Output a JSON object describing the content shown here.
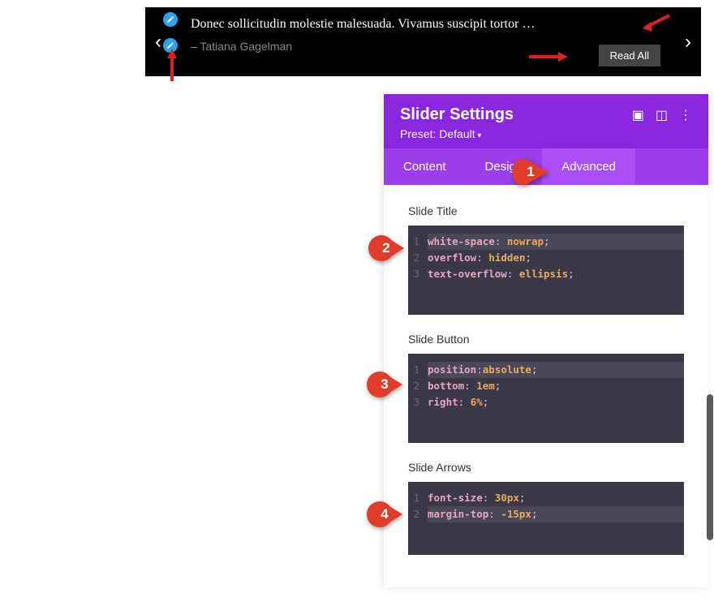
{
  "slider": {
    "quote": "Donec sollicitudin molestie malesuada. Vivamus suscipit tortor …",
    "author": "– Tatiana Gagelman",
    "read_all": "Read All"
  },
  "panel": {
    "title": "Slider Settings",
    "preset": "Preset: Default",
    "tabs": {
      "content": "Content",
      "design": "Design",
      "advanced": "Advanced"
    }
  },
  "sections": {
    "slide_title": {
      "label": "Slide Title",
      "lines": [
        {
          "n": "1",
          "prop": "white-space",
          "p1": ": ",
          "val": "nowrap",
          "p2": ";",
          "hl": true
        },
        {
          "n": "2",
          "prop": "overflow",
          "p1": ": ",
          "val": "hidden",
          "p2": ";",
          "hl": false
        },
        {
          "n": "3",
          "prop": "text-overflow",
          "p1": ": ",
          "val": "ellipsis",
          "p2": ";",
          "hl": false
        }
      ]
    },
    "slide_button": {
      "label": "Slide Button",
      "lines": [
        {
          "n": "1",
          "prop": "position",
          "p1": ":",
          "val": "absolute",
          "p2": ";",
          "hl": true
        },
        {
          "n": "2",
          "prop": "bottom",
          "p1": ": ",
          "val": "1em",
          "p2": ";",
          "hl": false
        },
        {
          "n": "3",
          "prop": "right",
          "p1": ": ",
          "val": "6%",
          "p2": ";",
          "hl": false
        }
      ]
    },
    "slide_arrows": {
      "label": "Slide Arrows",
      "lines": [
        {
          "n": "1",
          "prop": "font-size",
          "p1": ": ",
          "val": "30px",
          "p2": ";",
          "hl": false
        },
        {
          "n": "2",
          "prop": "margin-top",
          "p1": ": ",
          "val": "-15px",
          "p2": ";",
          "hl": true
        }
      ]
    }
  },
  "steps": {
    "s1": "1",
    "s2": "2",
    "s3": "3",
    "s4": "4"
  }
}
